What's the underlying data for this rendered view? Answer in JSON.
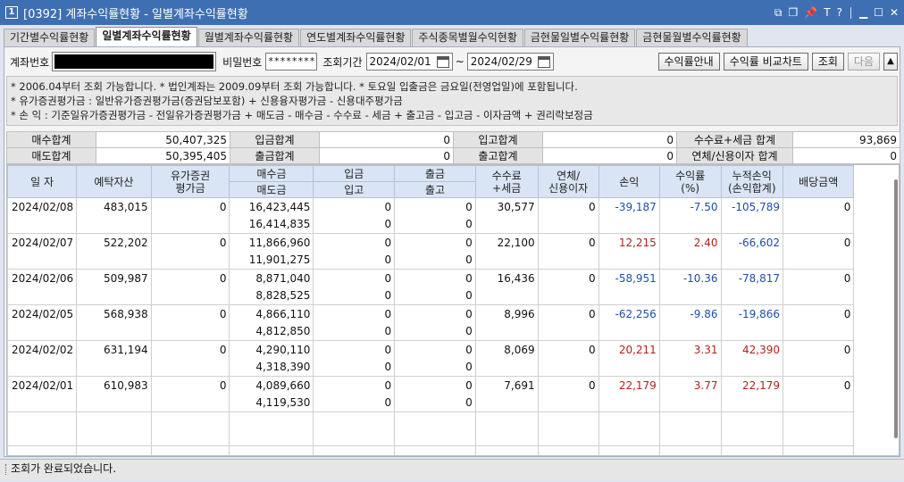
{
  "window": {
    "number": "1",
    "title": "[0392] 계좌수익률현황 - 일별계좌수익률현황",
    "icons": [
      "window-icon",
      "restore-icon",
      "pin-icon",
      "font-icon",
      "help-icon",
      "minimize-icon",
      "maximize-icon",
      "close-icon"
    ]
  },
  "tabs": [
    {
      "label": "기간별수익률현황"
    },
    {
      "label": "일별계좌수익률현황",
      "active": true
    },
    {
      "label": "월별계좌수익률현황"
    },
    {
      "label": "연도별계좌수익률현황"
    },
    {
      "label": "주식종목별월수익현황"
    },
    {
      "label": "금현물일별수익률현황"
    },
    {
      "label": "금현물월별수익률현황"
    }
  ],
  "query": {
    "account_label": "계좌번호",
    "password_label": "비밀번호",
    "password_value": "********",
    "period_label": "조회기간",
    "date_from": "2024/02/01",
    "date_to": "2024/02/29",
    "tilde": "~",
    "btn_guide": "수익률안내",
    "btn_chart": "수익률 비교차트",
    "btn_query": "조회",
    "btn_next": "다음",
    "btn_collapse": "▲"
  },
  "notes": [
    "* 2006.04부터 조회 가능합니다.  * 법인계좌는 2009.09부터 조회 가능합니다.  * 토요일 입출금은 금요일(전영업일)에 포함됩니다.",
    "* 유가증권평가금 : 일반유가증권평가금(증권담보포함) + 신용융자평가금 - 신용대주평가금",
    "* 손          익 : 기준일유가증권평가금 - 전일유가증권평가금 + 매도금 - 매수금 - 수수료 - 세금 + 출고금 - 입고금 - 이자금액 + 권리락보정금"
  ],
  "summary": {
    "buy_total_label": "매수합계",
    "buy_total": "50,407,325",
    "sell_total_label": "매도합계",
    "sell_total": "50,395,405",
    "deposit_total_label": "입금합계",
    "deposit_total": "0",
    "withdraw_total_label": "출금합계",
    "withdraw_total": "0",
    "in_total_label": "입고합계",
    "in_total": "0",
    "out_total_label": "출고합계",
    "out_total": "0",
    "fee_tax_label": "수수료+세금 합계",
    "fee_tax": "93,869",
    "overdue_label": "연체/신용이자 합계",
    "overdue": "0"
  },
  "grid": {
    "headers": {
      "date": "일 자",
      "deposit_assets": "예탁자산",
      "securities_eval": "유가증권\n평가금",
      "buy_amount": "매수금",
      "sell_amount": "매도금",
      "deposit": "입금",
      "in": "입고",
      "withdraw": "출금",
      "out": "출고",
      "fee_tax": "수수료\n+세금",
      "overdue_interest": "연체/\n신용이자",
      "pnl": "손익",
      "return_rate": "수익률\n(%)",
      "cum_pnl": "누적손익\n(손익합계)",
      "dividend": "배당금액"
    },
    "rows": [
      {
        "date": "2024/02/08",
        "deposit_assets": "483,015",
        "securities_eval": "0",
        "buy": "16,423,445",
        "sell": "16,414,835",
        "deposit": "0",
        "in": "0",
        "withdraw": "0",
        "out": "0",
        "fee_tax": "30,577",
        "overdue": "0",
        "pnl": "-39,187",
        "rate": "-7.50",
        "cum_pnl": "-105,789",
        "dividend": "0",
        "pnl_sign": "neg",
        "rate_sign": "neg",
        "cum_sign": "neg"
      },
      {
        "date": "2024/02/07",
        "deposit_assets": "522,202",
        "securities_eval": "0",
        "buy": "11,866,960",
        "sell": "11,901,275",
        "deposit": "0",
        "in": "0",
        "withdraw": "0",
        "out": "0",
        "fee_tax": "22,100",
        "overdue": "0",
        "pnl": "12,215",
        "rate": "2.40",
        "cum_pnl": "-66,602",
        "dividend": "0",
        "pnl_sign": "pos",
        "rate_sign": "pos",
        "cum_sign": "neg"
      },
      {
        "date": "2024/02/06",
        "deposit_assets": "509,987",
        "securities_eval": "0",
        "buy": "8,871,040",
        "sell": "8,828,525",
        "deposit": "0",
        "in": "0",
        "withdraw": "0",
        "out": "0",
        "fee_tax": "16,436",
        "overdue": "0",
        "pnl": "-58,951",
        "rate": "-10.36",
        "cum_pnl": "-78,817",
        "dividend": "0",
        "pnl_sign": "neg",
        "rate_sign": "neg",
        "cum_sign": "neg"
      },
      {
        "date": "2024/02/05",
        "deposit_assets": "568,938",
        "securities_eval": "0",
        "buy": "4,866,110",
        "sell": "4,812,850",
        "deposit": "0",
        "in": "0",
        "withdraw": "0",
        "out": "0",
        "fee_tax": "8,996",
        "overdue": "0",
        "pnl": "-62,256",
        "rate": "-9.86",
        "cum_pnl": "-19,866",
        "dividend": "0",
        "pnl_sign": "neg",
        "rate_sign": "neg",
        "cum_sign": "neg"
      },
      {
        "date": "2024/02/02",
        "deposit_assets": "631,194",
        "securities_eval": "0",
        "buy": "4,290,110",
        "sell": "4,318,390",
        "deposit": "0",
        "in": "0",
        "withdraw": "0",
        "out": "0",
        "fee_tax": "8,069",
        "overdue": "0",
        "pnl": "20,211",
        "rate": "3.31",
        "cum_pnl": "42,390",
        "dividend": "0",
        "pnl_sign": "pos",
        "rate_sign": "pos",
        "cum_sign": "pos"
      },
      {
        "date": "2024/02/01",
        "deposit_assets": "610,983",
        "securities_eval": "0",
        "buy": "4,089,660",
        "sell": "4,119,530",
        "deposit": "0",
        "in": "0",
        "withdraw": "0",
        "out": "0",
        "fee_tax": "7,691",
        "overdue": "0",
        "pnl": "22,179",
        "rate": "3.77",
        "cum_pnl": "22,179",
        "dividend": "0",
        "pnl_sign": "pos",
        "rate_sign": "pos",
        "cum_sign": "pos"
      }
    ]
  },
  "colors": {
    "negative": "#1d4fa8",
    "positive": "#b0231c",
    "titlebar": "#3f6fb3",
    "header_bg": "#d9e5f4"
  },
  "status": {
    "message": "조회가 완료되었습니다."
  }
}
